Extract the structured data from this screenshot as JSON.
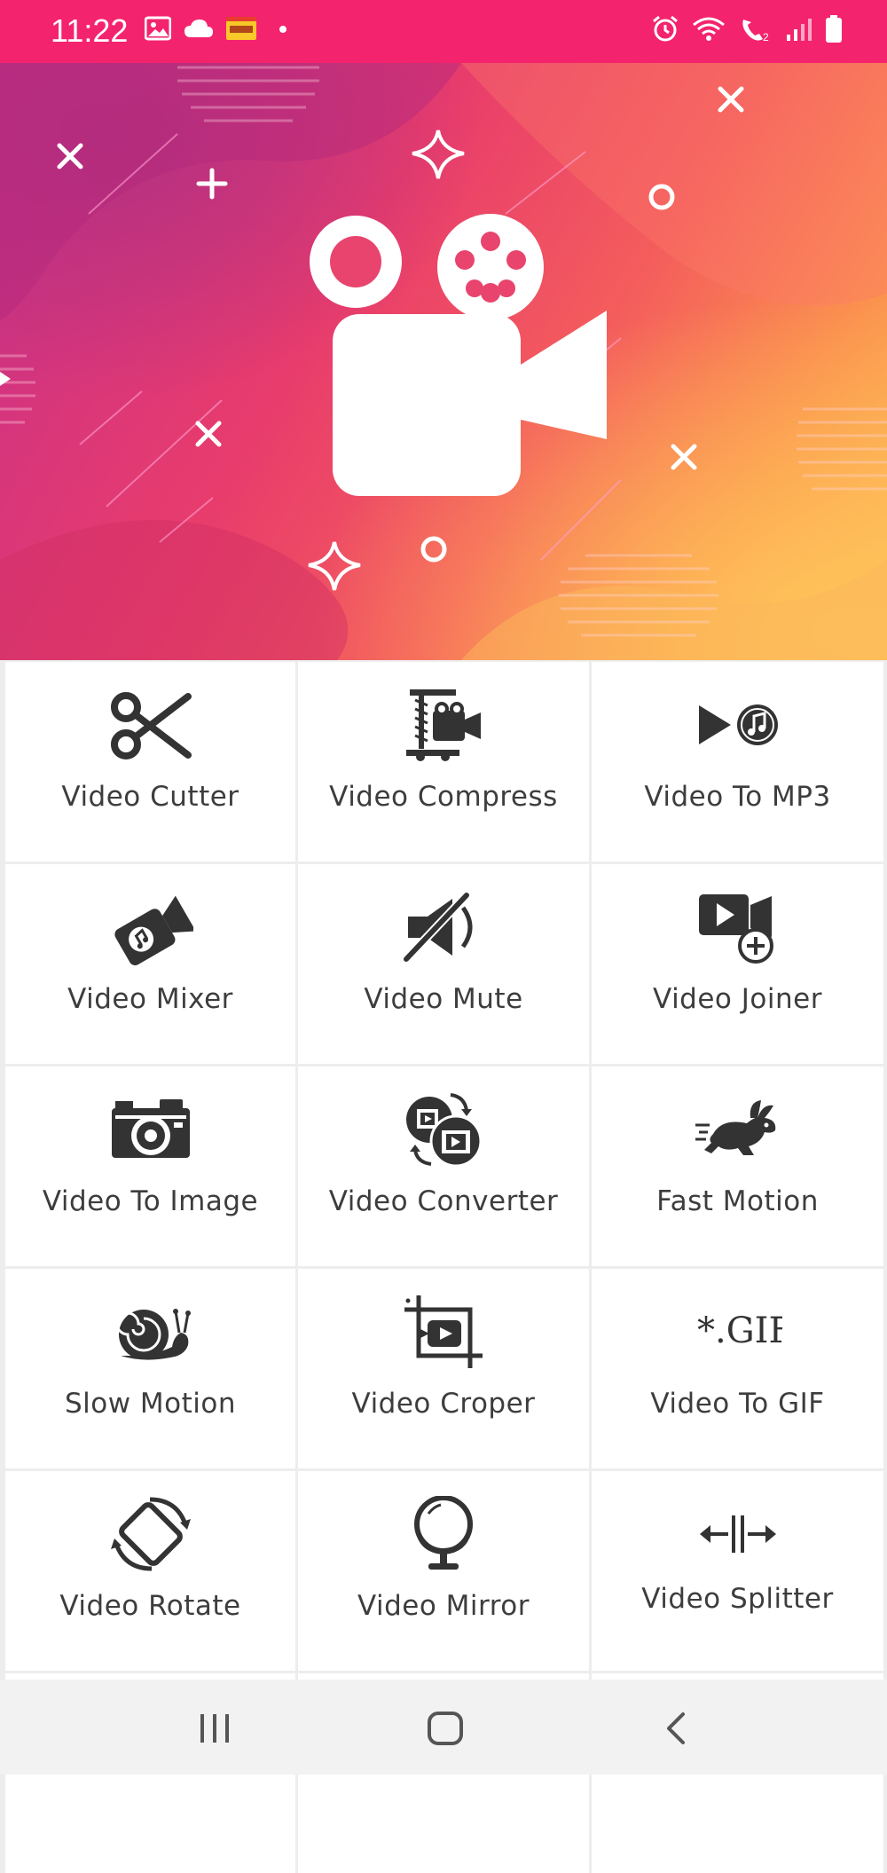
{
  "status_bar": {
    "time": "11:22",
    "left_icons": [
      "image-icon",
      "cloud-icon",
      "app-badge-icon",
      "dot-icon"
    ],
    "right_icons": [
      "alarm-icon",
      "wifi-icon",
      "call-icon",
      "signal-icon",
      "battery-icon"
    ],
    "background_color": "#f4236d"
  },
  "hero": {
    "icon": "movie-camera-icon"
  },
  "tools": [
    {
      "label": "Video Cutter",
      "icon": "scissors-icon"
    },
    {
      "label": "Video Compress",
      "icon": "compress-camera-icon"
    },
    {
      "label": "Video To MP3",
      "icon": "play-music-icon"
    },
    {
      "label": "Video Mixer",
      "icon": "music-camera-icon"
    },
    {
      "label": "Video Mute",
      "icon": "mute-speaker-icon"
    },
    {
      "label": "Video Joiner",
      "icon": "video-add-icon"
    },
    {
      "label": "Video To Image",
      "icon": "camera-icon"
    },
    {
      "label": "Video Converter",
      "icon": "convert-film-icon"
    },
    {
      "label": "Fast Motion",
      "icon": "rabbit-icon"
    },
    {
      "label": "Slow Motion",
      "icon": "snail-icon"
    },
    {
      "label": "Video Croper",
      "icon": "crop-video-icon"
    },
    {
      "label": "Video To GIF",
      "icon": "gif-icon"
    },
    {
      "label": "Video Rotate",
      "icon": "rotate-icon"
    },
    {
      "label": "Video Mirror",
      "icon": "mirror-icon"
    },
    {
      "label": "Video Splitter",
      "icon": "split-icon"
    }
  ],
  "nav_bar": {
    "buttons": [
      "recent-apps-icon",
      "home-icon",
      "back-icon"
    ]
  }
}
